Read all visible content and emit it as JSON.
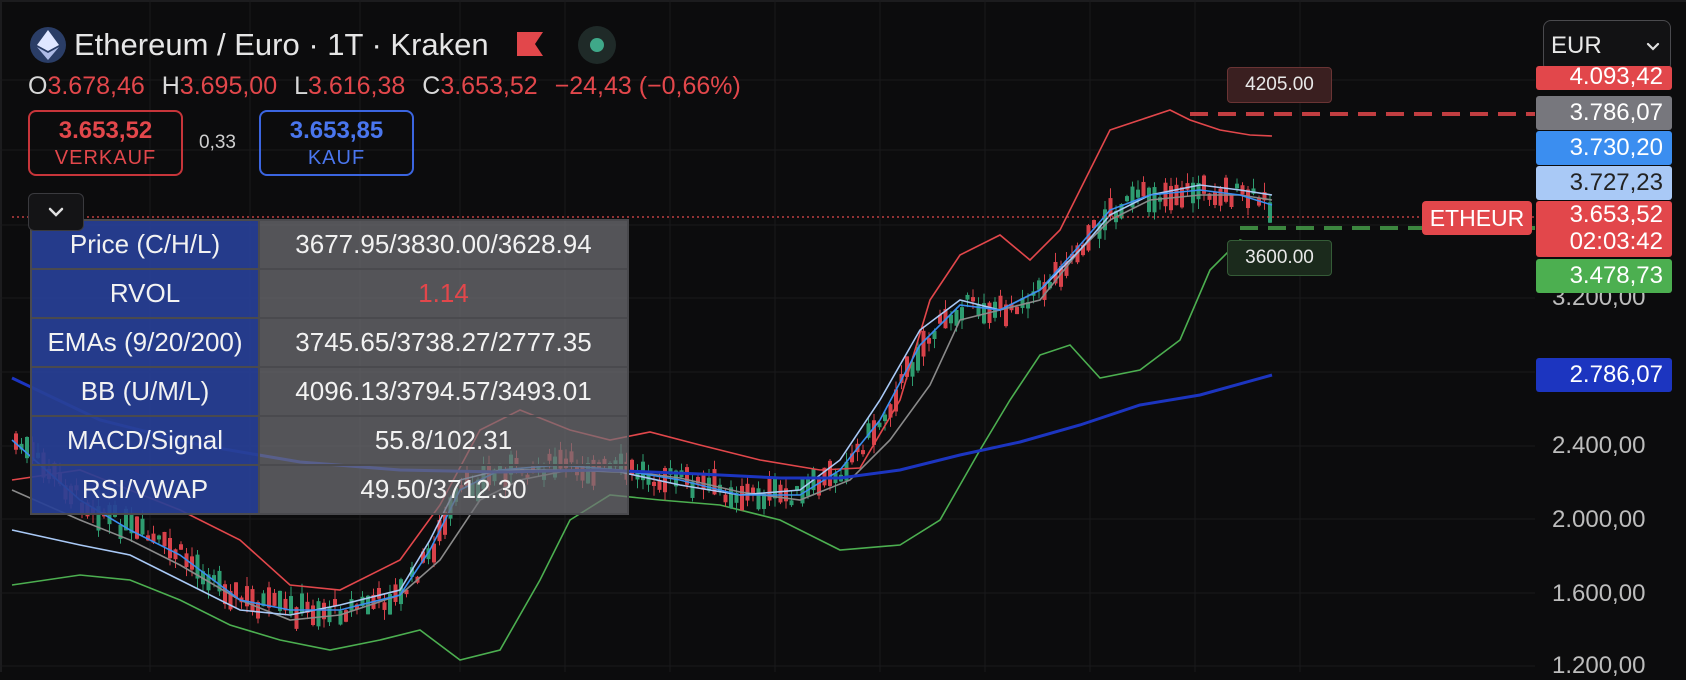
{
  "header": {
    "title": "Ethereum / Euro · 1T · Kraken",
    "coin_icon": "ethereum-icon",
    "flag_icon": "flag-icon"
  },
  "ohlc": {
    "o_label": "O",
    "o": "3.678,46",
    "h_label": "H",
    "h": "3.695,00",
    "l_label": "L",
    "l": "3.616,38",
    "c_label": "C",
    "c": "3.653,52",
    "change": "−24,43 (−0,66%)"
  },
  "trade": {
    "sell_price": "3.653,52",
    "sell_label": "VERKAUF",
    "spread": "0,33",
    "buy_price": "3.653,85",
    "buy_label": "KAUF"
  },
  "currency_select": {
    "value": "EUR"
  },
  "info_table": [
    {
      "label": "Price (C/H/L)",
      "value": "3677.95/3830.00/3628.94"
    },
    {
      "label": "RVOL",
      "value": "1.14"
    },
    {
      "label": "EMAs (9/20/200)",
      "value": "3745.65/3738.27/2777.35"
    },
    {
      "label": "BB (U/M/L)",
      "value": "4096.13/3794.57/3493.01"
    },
    {
      "label": "MACD/Signal",
      "value": "55.8/102.31"
    },
    {
      "label": "RSI/VWAP",
      "value": "49.50/3712.30"
    }
  ],
  "price_axis": [
    "3.200,00",
    "2.400,00",
    "2.000,00",
    "1.600,00",
    "1.200,00"
  ],
  "price_tags": {
    "bb_upper": "4.093,42",
    "ema_a": "3.786,07",
    "ema_b": "3.730,20",
    "ema_c": "3.727,23",
    "last": "3.653,52",
    "countdown": "02:03:42",
    "bb_lower": "3.478,73",
    "ema_200": "2.786,07"
  },
  "symbol_tag": "ETHEUR",
  "line_tags": {
    "upper": "4205.00",
    "lower": "3600.00"
  },
  "colors": {
    "red": "#e2474b",
    "green": "#4caf50",
    "blue": "#3b65e0",
    "ema200": "#1c35c0",
    "light_blue": "#6aa8ff",
    "grey": "#8a8a8a"
  }
}
